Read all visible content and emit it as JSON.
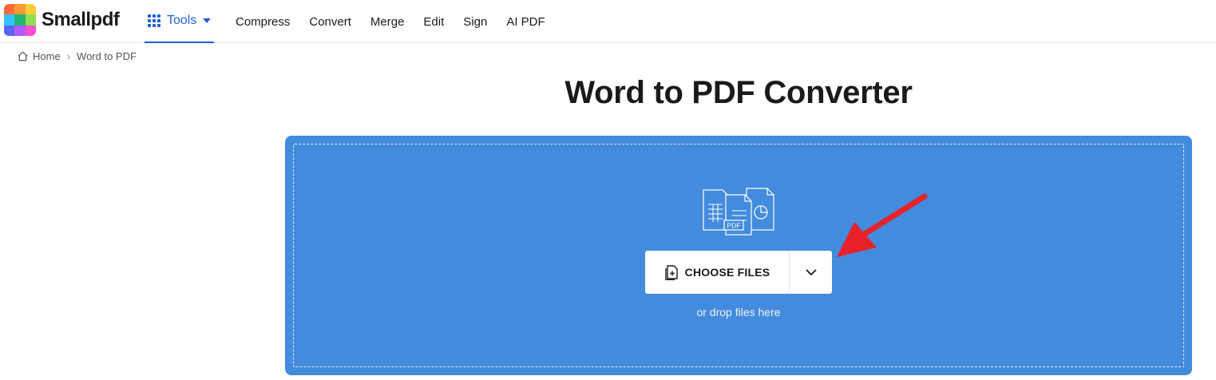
{
  "brand": {
    "name": "Smallpdf",
    "logo_colors": [
      "#ff6a3d",
      "#ff9933",
      "#ffcc33",
      "#33c3ff",
      "#22b573",
      "#8ee04f",
      "#5a66f2",
      "#b35cff",
      "#ff4fd1"
    ]
  },
  "nav": {
    "tools_label": "Tools",
    "links": [
      "Compress",
      "Convert",
      "Merge",
      "Edit",
      "Sign",
      "AI PDF"
    ],
    "accent_color": "#1f5fd6"
  },
  "breadcrumb": {
    "home": "Home",
    "separator": "›",
    "current": "Word to PDF"
  },
  "page": {
    "title": "Word to PDF Converter"
  },
  "dropzone": {
    "background": "#438bdc",
    "illustration_badge": "PDF",
    "choose_label": "CHOOSE FILES",
    "hint": "or drop files here"
  },
  "annotation": {
    "arrow_color": "#e8222a"
  }
}
